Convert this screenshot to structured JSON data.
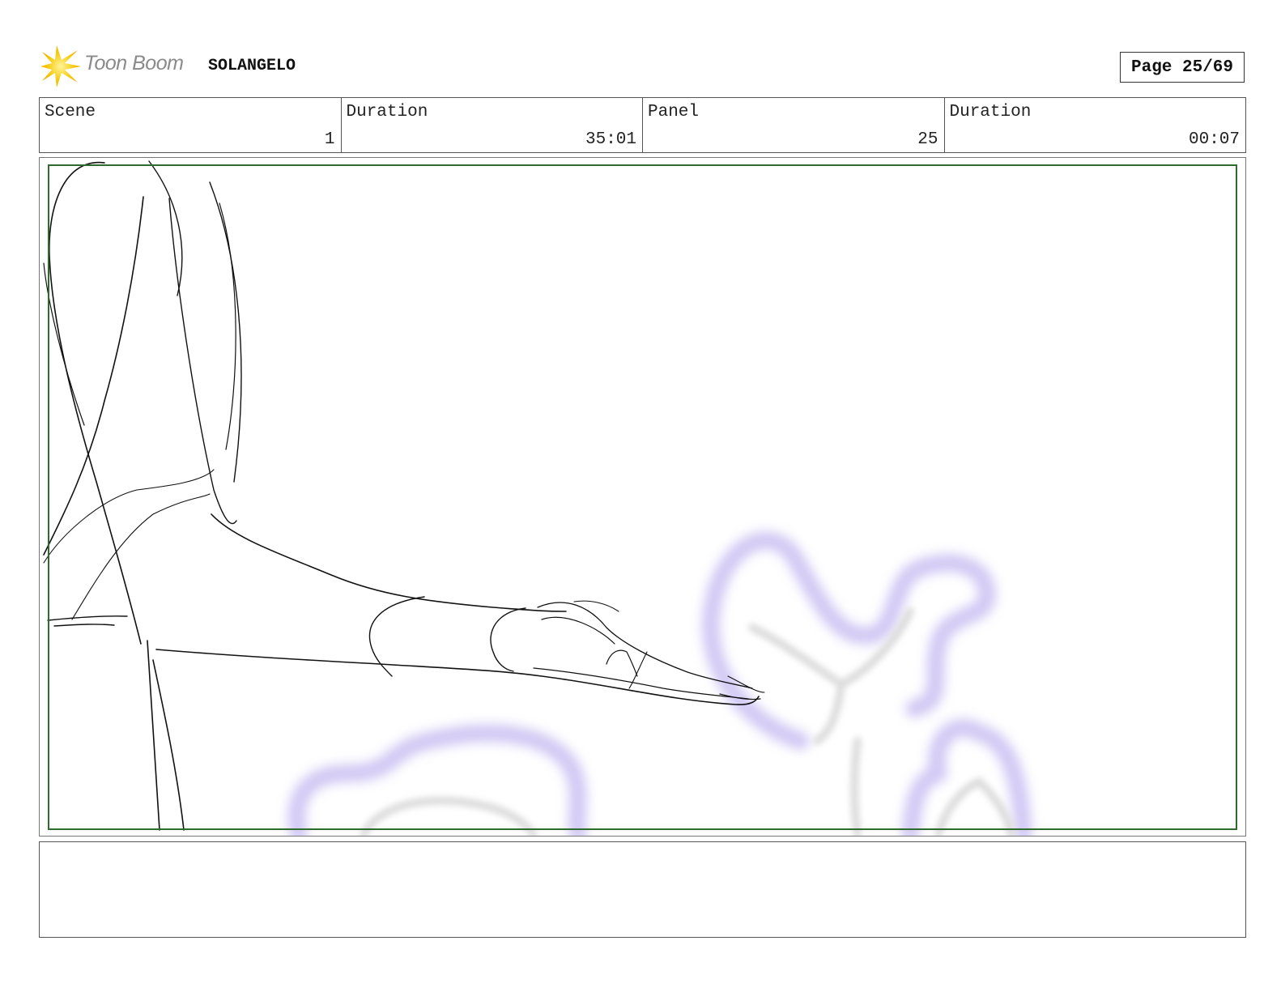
{
  "header": {
    "logo_text": "Toon Boom",
    "project_title": "SOLANGELO",
    "page_label": "Page 25/69"
  },
  "info": [
    {
      "label": "Scene",
      "value": "1"
    },
    {
      "label": "Duration",
      "value": "35:01"
    },
    {
      "label": "Panel",
      "value": "25"
    },
    {
      "label": "Duration",
      "value": "00:07"
    }
  ],
  "colors": {
    "safe_area": "#2f6b2f",
    "smoke_accent": "#c9bff2",
    "sketch_line": "#111111"
  },
  "icons": {
    "logo": "toon-boom-starburst-icon"
  },
  "notes": {
    "text": ""
  }
}
